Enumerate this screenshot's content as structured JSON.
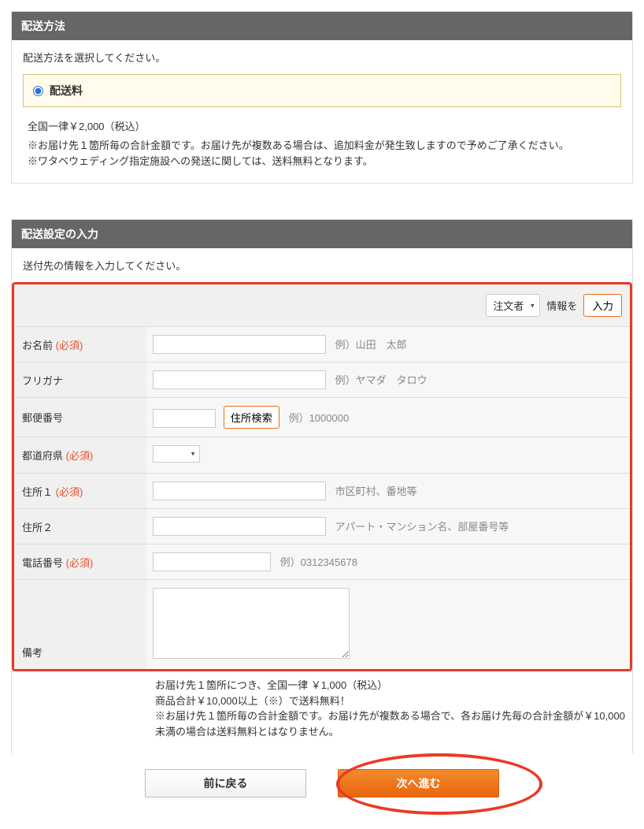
{
  "shipping_method": {
    "header": "配送方法",
    "description": "配送方法を選択してください。",
    "option_label": "配送料",
    "fee_text": "全国一律￥2,000（税込）",
    "note_line1": "※お届け先１箇所毎の合計金額です。お届け先が複数ある場合は、追加料金が発生致しますので予めご了承ください。",
    "note_line2": "※ワタベウェディング指定施設への発送に関しては、送料無料となります。"
  },
  "shipping_setting": {
    "header": "配送設定の入力",
    "description": "送付先の情報を入力してください。",
    "top_row": {
      "select_value": "注文者",
      "middle_text": "情報を",
      "button_label": "入力"
    },
    "fields": {
      "name": {
        "label": "お名前",
        "required": "(必須)",
        "hint": "例）山田　太郎"
      },
      "kana": {
        "label": "フリガナ",
        "required": "",
        "hint": "例）ヤマダ　タロウ"
      },
      "postal": {
        "label": "郵便番号",
        "required": "",
        "search_button": "住所検索",
        "hint": "例）1000000"
      },
      "pref": {
        "label": "都道府県",
        "required": "(必須)"
      },
      "addr1": {
        "label": "住所１",
        "required": "(必須)",
        "hint": "市区町村、番地等"
      },
      "addr2": {
        "label": "住所２",
        "required": "",
        "hint": "アパート・マンション名、部屋番号等"
      },
      "tel": {
        "label": "電話番号",
        "required": "(必須)",
        "hint": "例）0312345678"
      },
      "memo": {
        "label": "備考",
        "required": ""
      }
    },
    "bottom_note": {
      "line1": "お届け先１箇所につき、全国一律 ￥1,000（税込）",
      "line2": "商品合計￥10,000以上（※）で送料無料！",
      "line3": "※お届け先１箇所毎の合計金額です。お届け先が複数ある場合で、各お届け先毎の合計金額が￥10,000未満の場合は送料無料とはなりません。"
    }
  },
  "buttons": {
    "back": "前に戻る",
    "next": "次へ進む"
  }
}
